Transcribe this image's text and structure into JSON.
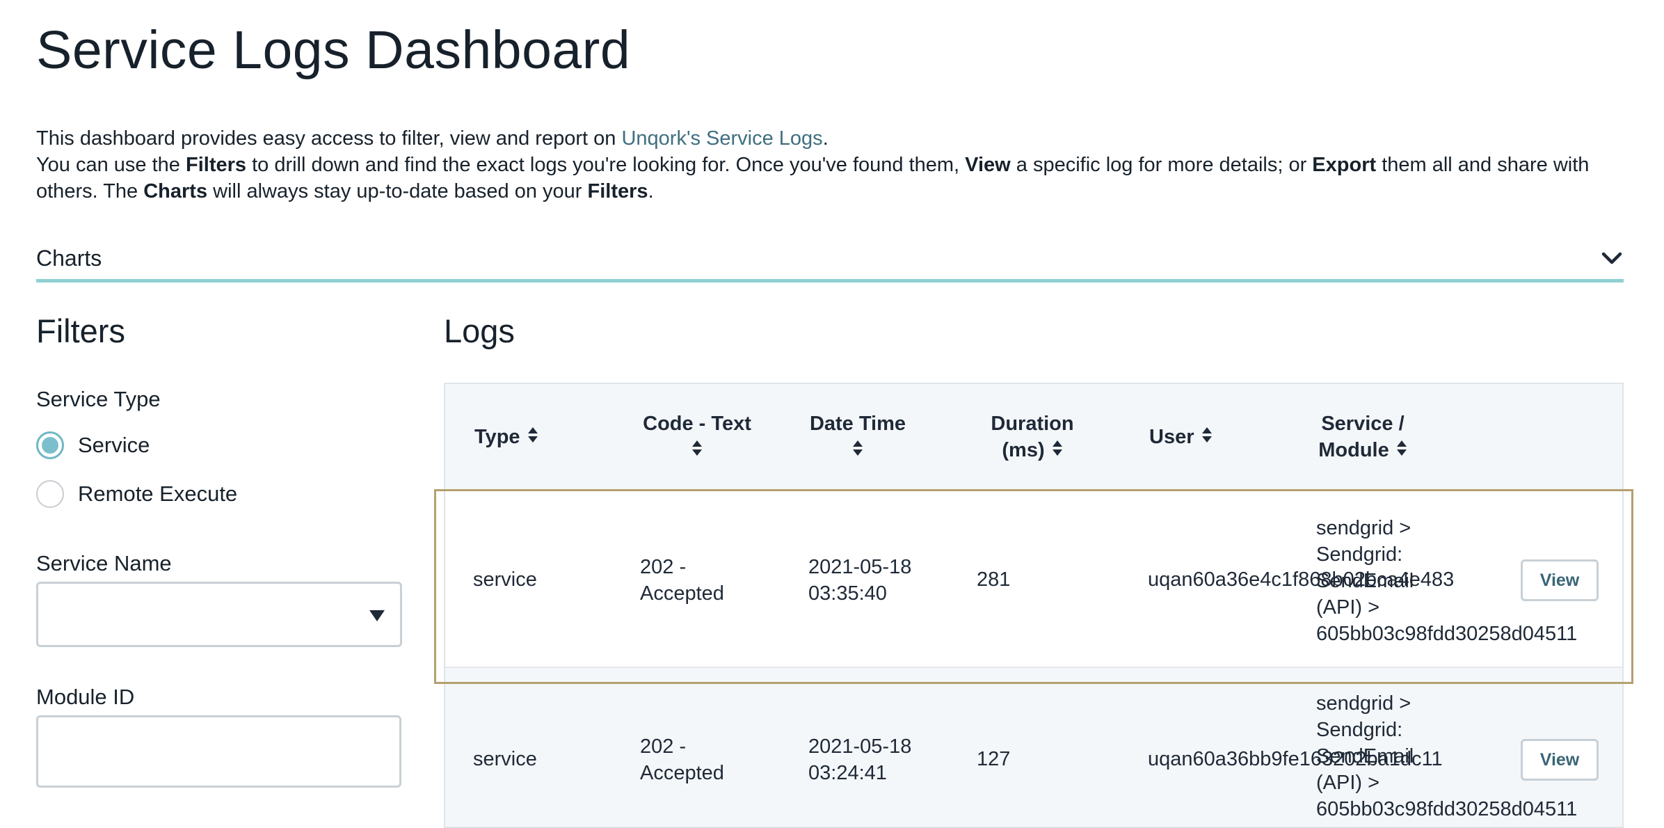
{
  "page": {
    "title": "Service Logs Dashboard",
    "intro": {
      "line1_prefix": "This dashboard provides easy access to filter, view and report on ",
      "link": "Unqork's Service Logs",
      "line1_suffix": ".",
      "line2_a": "You can use the ",
      "line2_b": "Filters",
      "line2_c": " to drill down and find the exact logs you're looking for. Once you've found them, ",
      "line2_d": "View",
      "line2_e": " a specific log for more details; or ",
      "line2_f": "Export",
      "line2_g": " them all and share with others. The ",
      "line2_h": "Charts",
      "line2_i": " will always stay up-to-date based on your ",
      "line2_j": "Filters",
      "line2_k": "."
    },
    "charts_label": "Charts"
  },
  "filters": {
    "title": "Filters",
    "service_type": {
      "label": "Service Type",
      "options": [
        {
          "label": "Service",
          "checked": true
        },
        {
          "label": "Remote Execute",
          "checked": false
        }
      ]
    },
    "service_name": {
      "label": "Service Name",
      "value": ""
    },
    "module_id": {
      "label": "Module ID",
      "value": ""
    }
  },
  "logs": {
    "title": "Logs",
    "columns": {
      "type": "Type",
      "code_text": "Code - Text",
      "date_time": "Date Time",
      "duration_1": "Duration",
      "duration_2": "(ms)",
      "user": "User",
      "service_module_1": "Service /",
      "service_module_2": "Module"
    },
    "rows": [
      {
        "type": "service",
        "code_1": "202 -",
        "code_2": "Accepted",
        "date_1": "2021-05-18",
        "date_2": "03:35:40",
        "duration": "281",
        "user": "uqan60a36e4c1f868b02bca4e483",
        "service_1": "sendgrid >",
        "service_2": "Sendgrid:",
        "service_3": "SendEmail",
        "service_4": "(API) >",
        "service_5": "605bb03c98fdd30258d04511",
        "view": "View"
      },
      {
        "type": "service",
        "code_1": "202 -",
        "code_2": "Accepted",
        "date_1": "2021-05-18",
        "date_2": "03:24:41",
        "duration": "127",
        "user": "uqan60a36bb9fe163202ba1dc11",
        "service_1": "sendgrid >",
        "service_2": "Sendgrid:",
        "service_3": "SendEmail",
        "service_4": "(API) >",
        "service_5": "605bb03c98fdd30258d04511",
        "view": "View"
      }
    ]
  },
  "colors": {
    "accent": "#8fd0d0",
    "link": "#3f6f7f",
    "radio": "#7bbfcd",
    "highlight": "#b5a06e"
  }
}
